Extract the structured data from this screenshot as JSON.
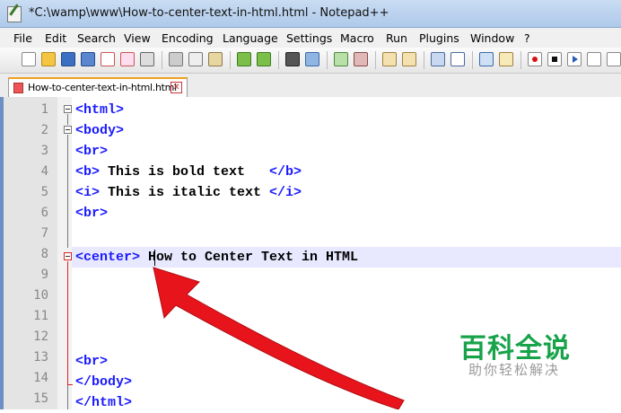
{
  "window": {
    "title": "*C:\\wamp\\www\\How-to-center-text-in-html.html - Notepad++"
  },
  "menu": [
    "File",
    "Edit",
    "Search",
    "View",
    "Encoding",
    "Language",
    "Settings",
    "Macro",
    "Run",
    "Plugins",
    "Window",
    "?"
  ],
  "tab": {
    "label": "How-to-center-text-in-html.html",
    "close": "✕"
  },
  "editor": {
    "line_numbers": [
      "1",
      "2",
      "3",
      "4",
      "5",
      "6",
      "7",
      "8",
      "9",
      "10",
      "11",
      "12",
      "13",
      "14",
      "15"
    ],
    "lines": {
      "l1": "<html>",
      "l2": "<body>",
      "l3": "<br>",
      "l4_open": "<b>",
      "l4_text": " This is bold text   ",
      "l4_close": "</b>",
      "l5_open": "<i>",
      "l5_text": " This is italic text ",
      "l5_close": "</i>",
      "l6": "<br>",
      "l8_open": "<center>",
      "l8_text": " How to Center Text in HTML",
      "l13": "<br>",
      "l14": "</body>",
      "l15": "</html>"
    },
    "current_line": 8
  },
  "annotation": {
    "arrow_color": "#e8141b",
    "icon": "arrow-icon"
  },
  "watermark": {
    "main": "百科全说",
    "sub": "助你轻松解决",
    "color": "#18a34a"
  }
}
